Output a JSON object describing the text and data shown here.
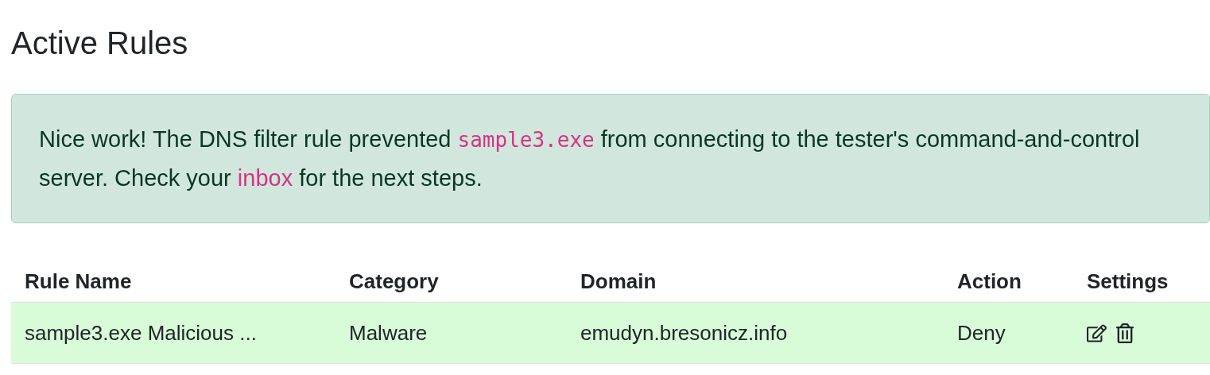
{
  "title": "Active Rules",
  "alert": {
    "parts": [
      {
        "kind": "text",
        "text": "Nice work! The DNS filter rule prevented "
      },
      {
        "kind": "code",
        "text": "sample3.exe"
      },
      {
        "kind": "text",
        "text": " from connecting to the tester's command-and-control server. Check your "
      },
      {
        "kind": "link",
        "text": "inbox"
      },
      {
        "kind": "text",
        "text": " for the next steps."
      }
    ]
  },
  "table": {
    "columns": [
      "Rule Name",
      "Category",
      "Domain",
      "Action",
      "Settings"
    ],
    "rows": [
      {
        "highlighted": true,
        "cells": [
          "sample3.exe Malicious ...",
          "Malware",
          "emudyn.bresonicz.info",
          "Deny"
        ]
      }
    ]
  }
}
